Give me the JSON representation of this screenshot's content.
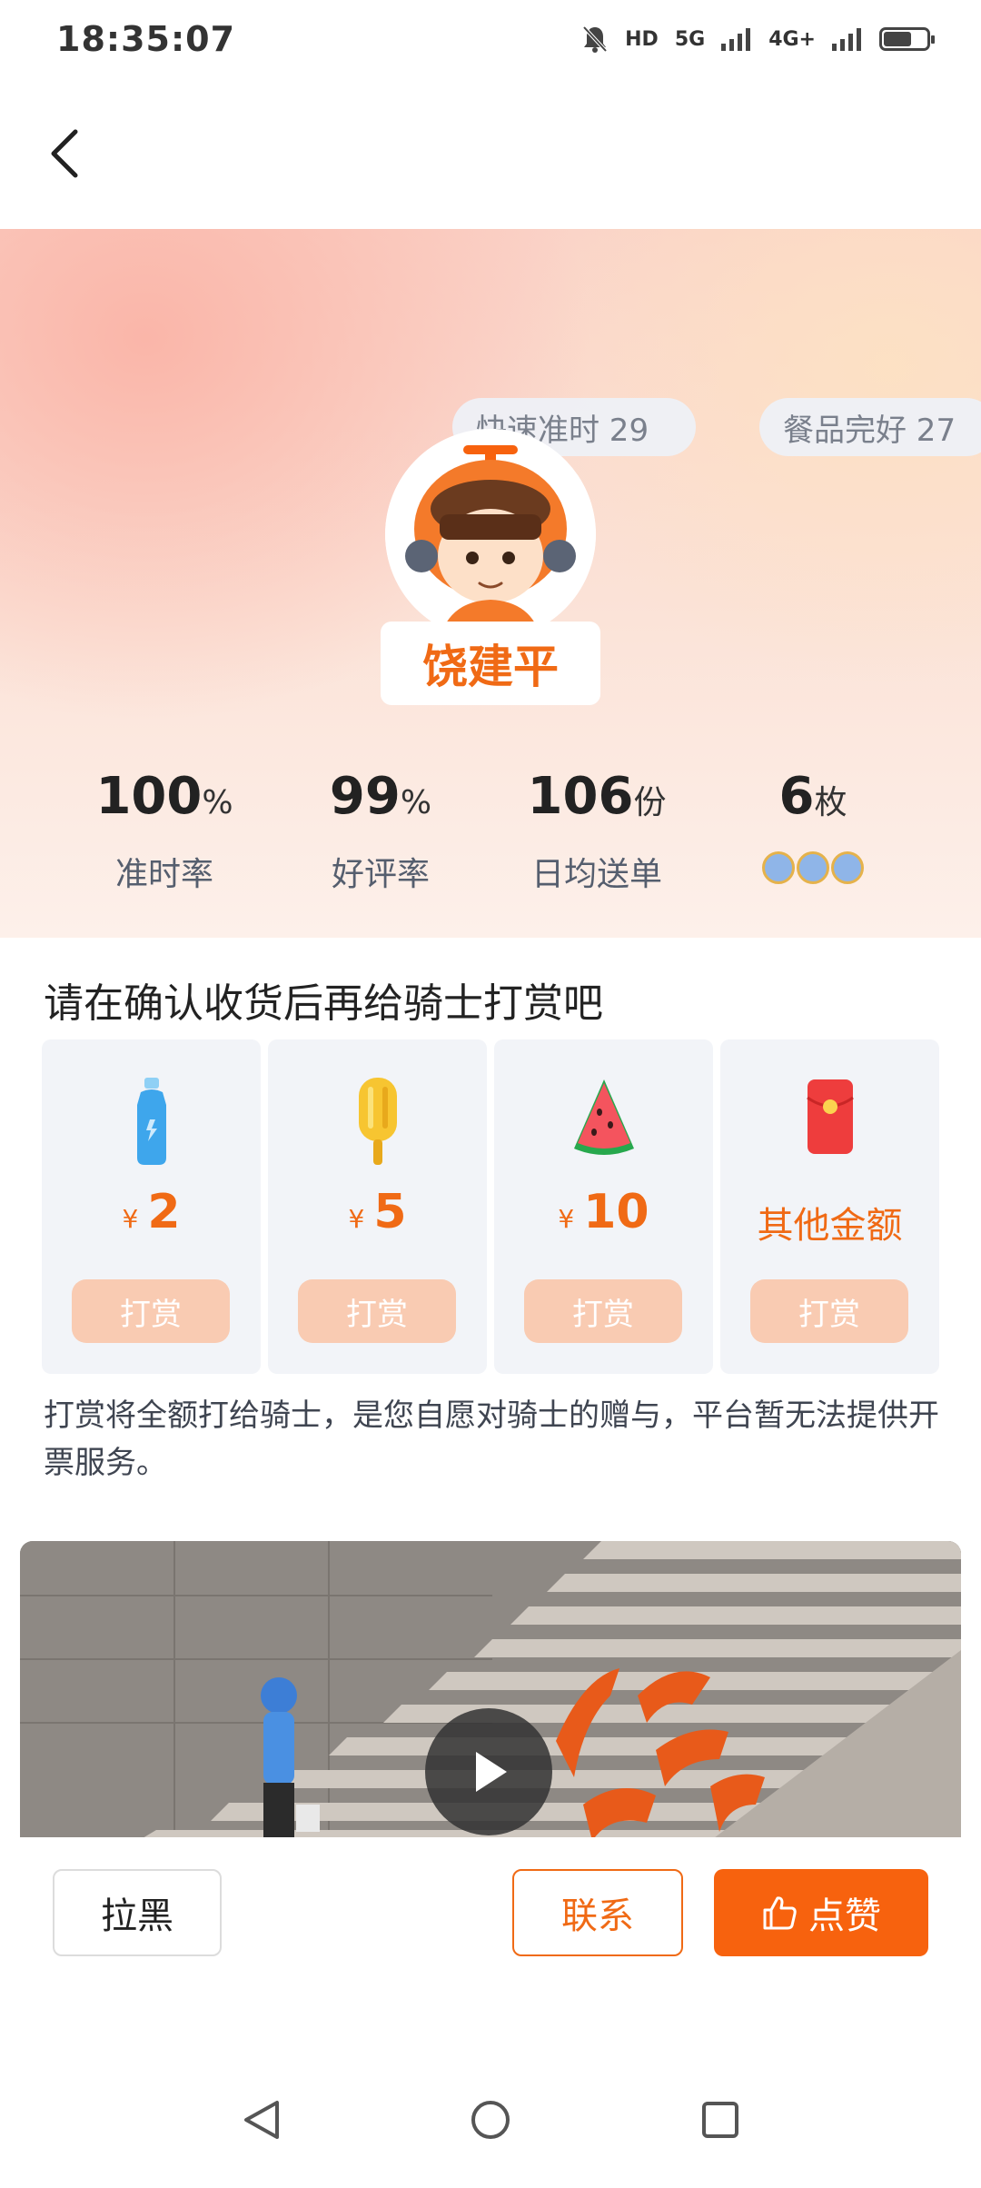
{
  "status_bar": {
    "time": "18:35:07",
    "hd": "HD",
    "net_5g": "5G",
    "net_4g": "4G+"
  },
  "hero": {
    "tags": [
      "快速准时 29",
      "餐品完好 27"
    ],
    "rider_name": "饶建平",
    "stats": [
      {
        "value": "100",
        "unit": "%",
        "label": "准时率"
      },
      {
        "value": "99",
        "unit": "%",
        "label": "好评率"
      },
      {
        "value": "106",
        "unit": "份",
        "label": "日均送单"
      },
      {
        "value": "6",
        "unit": "枚",
        "label": ""
      }
    ]
  },
  "tip": {
    "title": "请在确认收货后再给骑士打赏吧",
    "currency": "¥",
    "options": [
      {
        "amount": "2",
        "icon": "water-bottle-icon",
        "button": "打赏"
      },
      {
        "amount": "5",
        "icon": "popsicle-icon",
        "button": "打赏"
      },
      {
        "amount": "10",
        "icon": "watermelon-icon",
        "button": "打赏"
      },
      {
        "amount": "其他金额",
        "icon": "red-envelope-icon",
        "button": "打赏"
      }
    ],
    "note": "打赏将全额打给骑士，是您自愿对骑士的赠与，平台暂无法提供开票服务。"
  },
  "bottom": {
    "block_label": "拉黑",
    "contact_label": "联系",
    "like_label": "点赞"
  },
  "colors": {
    "accent": "#f06a15",
    "like_bg": "#f7620e",
    "tip_button": "#f9cbb2"
  }
}
